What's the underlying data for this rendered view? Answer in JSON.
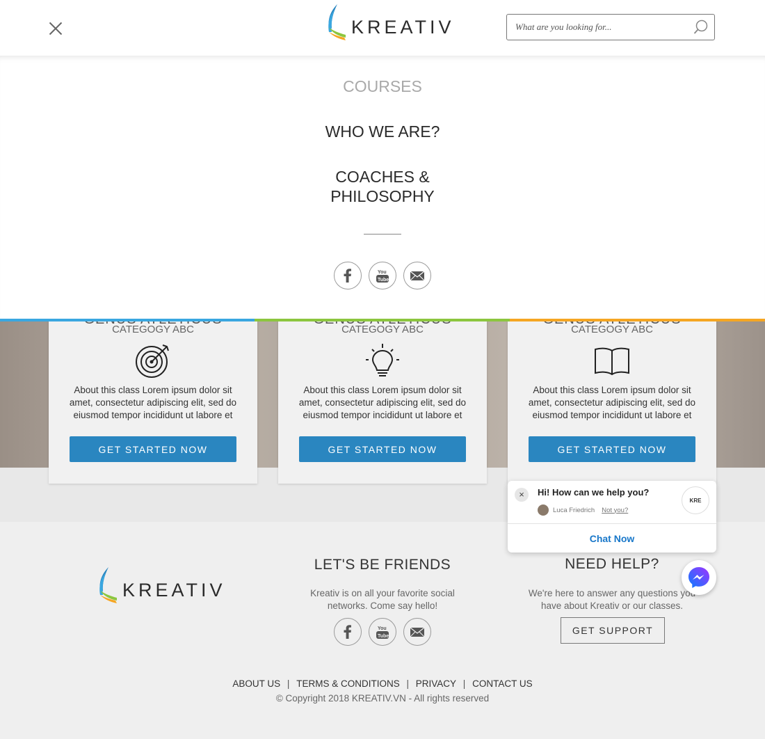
{
  "brand": {
    "logo_text": "KREATIV",
    "accent_blue": "#2a86c0",
    "stripe_colors": [
      "#3aa7e0",
      "#8cc63f",
      "#f5a623"
    ]
  },
  "header": {
    "search_placeholder": "What are you looking for..."
  },
  "menu": {
    "items": [
      {
        "label": "COURSES",
        "active": true
      },
      {
        "label": "WHO WE ARE?",
        "active": false
      },
      {
        "label": "COACHES &",
        "active": false
      },
      {
        "label": "PHILOSOPHY",
        "active": false
      }
    ],
    "social": [
      "facebook-icon",
      "youtube-icon",
      "email-icon"
    ]
  },
  "cards": [
    {
      "title": "GENUS ATLETICUS",
      "category": "CATEGOGY ABC",
      "icon": "target-icon",
      "description": "About this class Lorem ipsum dolor sit amet, consectetur adipiscing elit, sed do eiusmod tempor incididunt ut labore et dolore magna aliqua.",
      "button": "GET STARTED NOW"
    },
    {
      "title": "GENUS ATLETICUS",
      "category": "CATEGOGY ABC",
      "icon": "lightbulb-icon",
      "description": "About this class Lorem ipsum dolor sit amet, consectetur adipiscing elit, sed do eiusmod tempor incididunt ut labore et dolore magna aliqua.",
      "button": "GET STARTED NOW"
    },
    {
      "title": "GENUS ATLETICUS",
      "category": "CATEGOGY ABC",
      "icon": "book-icon",
      "description": "About this class Lorem ipsum dolor sit amet, consectetur adipiscing elit, sed do eiusmod tempor incididunt ut labore et dolore magna aliqua.",
      "button": "GET STARTED NOW"
    }
  ],
  "footer": {
    "friends_title": "LET'S BE FRIENDS",
    "friends_text_1": "Kreativ is on all your favorite social",
    "friends_text_2": "networks. Come say hello!",
    "help_title": "NEED HELP?",
    "help_text_1": "We're here to answer any questions you",
    "help_text_2": "have about Kreativ or our classes.",
    "support_button": "GET SUPPORT",
    "links": [
      "ABOUT US",
      "TERMS & CONDITIONS",
      "PRIVACY",
      "CONTACT US"
    ],
    "separator": "|",
    "copyright": "© Copyright 2018 KREATIV.VN - All rights reserved"
  },
  "chat": {
    "close": "×",
    "question": "Hi! How can we help you?",
    "user_name": "Luca Friedrich",
    "not_you": "Not you?",
    "logo_text": "KRE",
    "chat_now": "Chat Now"
  }
}
